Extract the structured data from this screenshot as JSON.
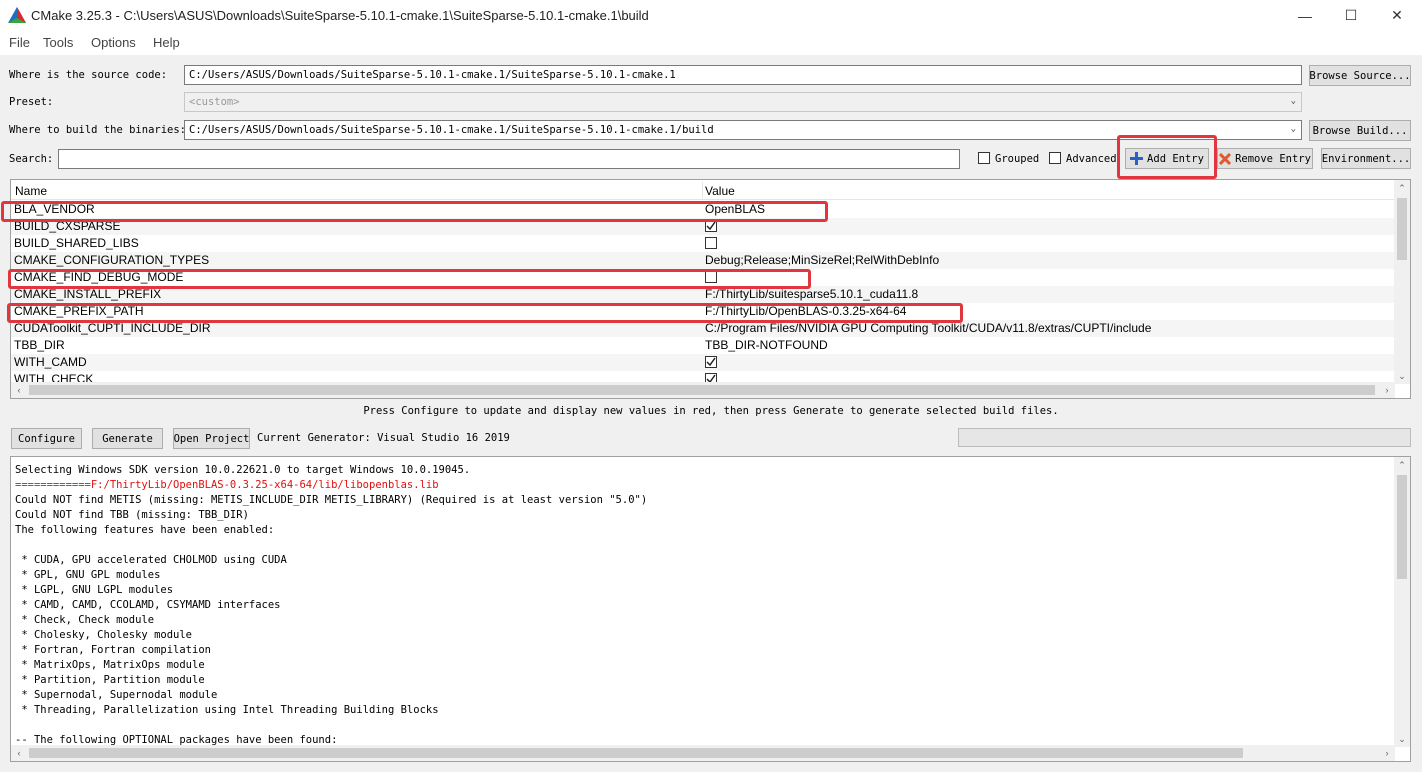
{
  "window": {
    "title": "CMake 3.25.3 - C:\\Users\\ASUS\\Downloads\\SuiteSparse-5.10.1-cmake.1\\SuiteSparse-5.10.1-cmake.1\\build",
    "minimize": "—",
    "maximize": "☐",
    "close": "✕"
  },
  "menu": [
    "File",
    "Tools",
    "Options",
    "Help"
  ],
  "source": {
    "label": "Where is the source code:",
    "value": "C:/Users/ASUS/Downloads/SuiteSparse-5.10.1-cmake.1/SuiteSparse-5.10.1-cmake.1",
    "button": "Browse Source..."
  },
  "preset": {
    "label": "Preset:",
    "value": "<custom>"
  },
  "build": {
    "label": "Where to build the binaries:",
    "value": "C:/Users/ASUS/Downloads/SuiteSparse-5.10.1-cmake.1/SuiteSparse-5.10.1-cmake.1/build",
    "button": "Browse Build..."
  },
  "search": {
    "label": "Search:",
    "value": "",
    "grouped": "Grouped",
    "advanced": "Advanced",
    "add_entry": "Add Entry",
    "remove_entry": "Remove Entry",
    "environment": "Environment..."
  },
  "table": {
    "col_name": "Name",
    "col_value": "Value",
    "rows": [
      {
        "name": "BLA_VENDOR",
        "value": "OpenBLAS",
        "type": "text"
      },
      {
        "name": "BUILD_CXSPARSE",
        "value": "ON",
        "type": "bool"
      },
      {
        "name": "BUILD_SHARED_LIBS",
        "value": "OFF",
        "type": "bool"
      },
      {
        "name": "CMAKE_CONFIGURATION_TYPES",
        "value": "Debug;Release;MinSizeRel;RelWithDebInfo",
        "type": "text"
      },
      {
        "name": "CMAKE_FIND_DEBUG_MODE",
        "value": "OFF",
        "type": "bool"
      },
      {
        "name": "CMAKE_INSTALL_PREFIX",
        "value": "F:/ThirtyLib/suitesparse5.10.1_cuda11.8",
        "type": "text"
      },
      {
        "name": "CMAKE_PREFIX_PATH",
        "value": "F:/ThirtyLib/OpenBLAS-0.3.25-x64-64",
        "type": "text"
      },
      {
        "name": "CUDAToolkit_CUPTI_INCLUDE_DIR",
        "value": "C:/Program Files/NVIDIA GPU Computing Toolkit/CUDA/v11.8/extras/CUPTI/include",
        "type": "text"
      },
      {
        "name": "TBB_DIR",
        "value": "TBB_DIR-NOTFOUND",
        "type": "text"
      },
      {
        "name": "WITH_CAMD",
        "value": "ON",
        "type": "bool"
      },
      {
        "name": "WITH_CHECK",
        "value": "ON",
        "type": "bool"
      }
    ]
  },
  "hint": "Press Configure to update and display new values in red, then press Generate to generate selected build files.",
  "actions": {
    "configure": "Configure",
    "generate": "Generate",
    "open_project": "Open Project",
    "generator": "Current Generator: Visual Studio 16 2019"
  },
  "log": [
    {
      "text": "Selecting Windows SDK version 10.0.22621.0 to target Windows 10.0.19045.",
      "err": false
    },
    {
      "text": "============F:/ThirtyLib/OpenBLAS-0.3.25-x64-64/lib/libopenblas.lib",
      "err": true
    },
    {
      "text": "Could NOT find METIS (missing: METIS_INCLUDE_DIR METIS_LIBRARY) (Required is at least version \"5.0\")",
      "err": false
    },
    {
      "text": "Could NOT find TBB (missing: TBB_DIR)",
      "err": false
    },
    {
      "text": "The following features have been enabled:",
      "err": false
    },
    {
      "text": "",
      "err": false
    },
    {
      "text": " * CUDA, GPU accelerated CHOLMOD using CUDA",
      "err": false
    },
    {
      "text": " * GPL, GNU GPL modules",
      "err": false
    },
    {
      "text": " * LGPL, GNU LGPL modules",
      "err": false
    },
    {
      "text": " * CAMD, CAMD, CCOLAMD, CSYMAMD interfaces",
      "err": false
    },
    {
      "text": " * Check, Check module",
      "err": false
    },
    {
      "text": " * Cholesky, Cholesky module",
      "err": false
    },
    {
      "text": " * Fortran, Fortran compilation",
      "err": false
    },
    {
      "text": " * MatrixOps, MatrixOps module",
      "err": false
    },
    {
      "text": " * Partition, Partition module",
      "err": false
    },
    {
      "text": " * Supernodal, Supernodal module",
      "err": false
    },
    {
      "text": " * Threading, Parallelization using Intel Threading Building Blocks",
      "err": false
    },
    {
      "text": "",
      "err": false
    },
    {
      "text": "-- The following OPTIONAL packages have been found:",
      "err": false
    }
  ],
  "colors": {
    "highlight": "#e0373e",
    "error_text": "#e01010",
    "window_bg": "#f0f0f0"
  }
}
